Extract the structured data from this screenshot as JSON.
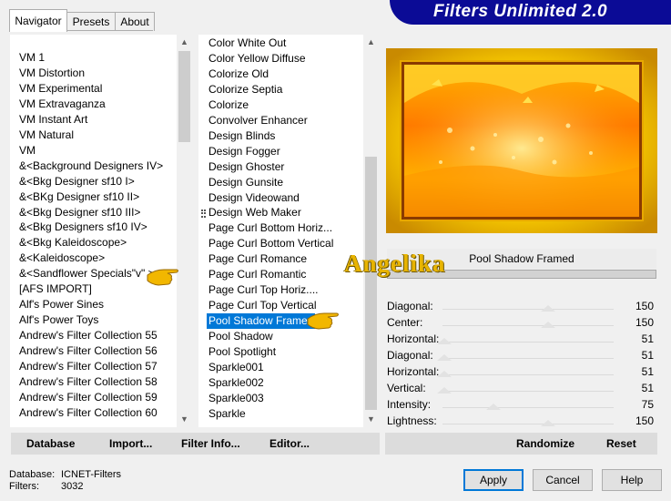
{
  "tabs": [
    {
      "label": "Navigator",
      "active": true
    },
    {
      "label": "Presets",
      "active": false
    },
    {
      "label": "About",
      "active": false
    }
  ],
  "banner": {
    "title": "Filters Unlimited 2.0"
  },
  "categories": [
    "VM 1",
    "VM Distortion",
    "VM Experimental",
    "VM Extravaganza",
    "VM Instant Art",
    "VM Natural",
    "VM",
    "&<Background Designers IV>",
    "&<Bkg Designer sf10 I>",
    "&<BKg Designer sf10 II>",
    "&<Bkg Designer sf10 III>",
    "&<Bkg Designers sf10 IV>",
    "&<Bkg Kaleidoscope>",
    "&<Kaleidoscope>",
    "&<Sandflower Specials\"v\" >",
    "[AFS IMPORT]",
    "Alf's Power Sines",
    "Alf's Power Toys",
    "Andrew's Filter Collection 55",
    "Andrew's Filter Collection 56",
    "Andrew's Filter Collection 57",
    "Andrew's Filter Collection 58",
    "Andrew's Filter Collection 59",
    "Andrew's Filter Collection 60"
  ],
  "filters": [
    "Color White Out",
    "Color Yellow Diffuse",
    "Colorize Old",
    "Colorize Septia",
    "Colorize",
    "Convolver Enhancer",
    "Design Blinds",
    "Design Fogger",
    "Design Ghoster",
    "Design Gunsite",
    "Design Videowand",
    "Design Web Maker",
    "Page Curl Bottom Horiz...",
    "Page Curl Bottom Vertical",
    "Page Curl Romance",
    "Page Curl Romantic",
    "Page Curl Top Horiz....",
    "Page Curl Top Vertical",
    "Pool Shadow Framed",
    "Pool Shadow",
    "Pool Spotlight",
    "Sparkle001",
    "Sparkle002",
    "Sparkle003",
    "Sparkle"
  ],
  "selected_filter_index": 18,
  "filter_name": "Pool Shadow Framed",
  "sliders": [
    {
      "label": "Diagonal:",
      "value": "150"
    },
    {
      "label": "Center:",
      "value": "150"
    },
    {
      "label": "Horizontal:",
      "value": "51"
    },
    {
      "label": "Diagonal:",
      "value": "51"
    },
    {
      "label": "Horizontal:",
      "value": "51"
    },
    {
      "label": "Vertical:",
      "value": "51"
    },
    {
      "label": "Intensity:",
      "value": "75"
    },
    {
      "label": "Lightness:",
      "value": "150"
    }
  ],
  "left_actions": {
    "database": "Database",
    "import": "Import...",
    "filter_info": "Filter Info...",
    "editor": "Editor..."
  },
  "right_actions": {
    "randomize": "Randomize",
    "reset": "Reset"
  },
  "buttons": {
    "apply": "Apply",
    "cancel": "Cancel",
    "help": "Help"
  },
  "info": {
    "database_label": "Database:",
    "database_value": "ICNET-Filters",
    "filters_label": "Filters:",
    "filters_value": "3032"
  },
  "watermark": "Angelika",
  "colors": {
    "banner": "#0b0b96",
    "selection": "#0078d7",
    "hand": "#f2b700"
  }
}
